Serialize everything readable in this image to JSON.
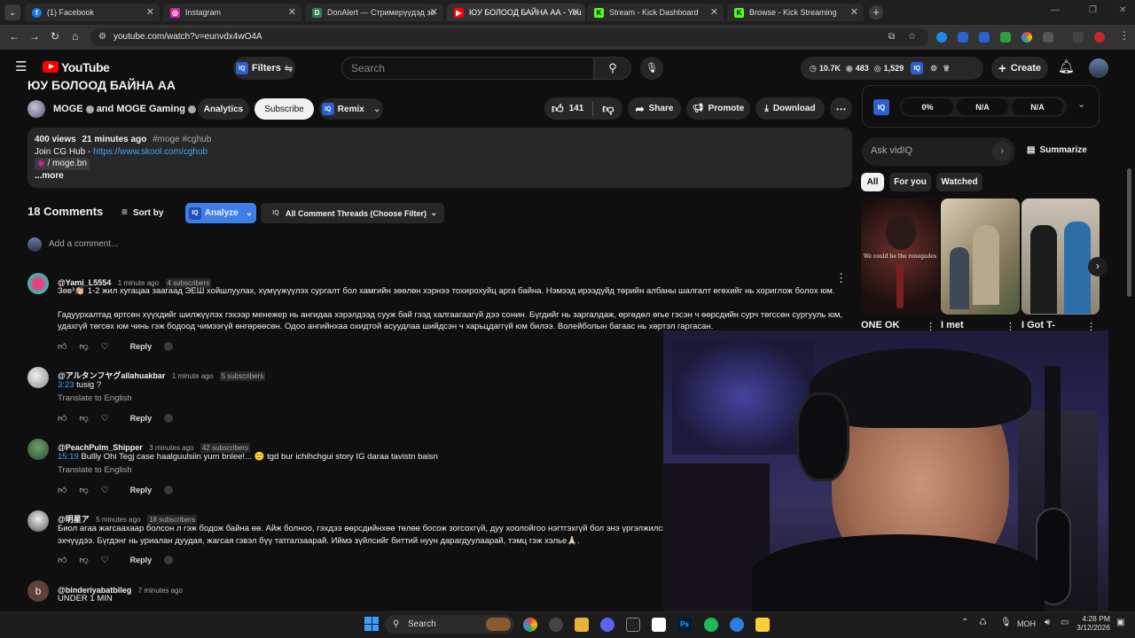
{
  "browser": {
    "tabs": [
      {
        "title": "(1) Facebook",
        "icon": "facebook-icon",
        "color": "#1877f2"
      },
      {
        "title": "Instagram",
        "icon": "instagram-icon",
        "color": "#d6249f"
      },
      {
        "title": "DonAlert — Стримерүүдэд зо",
        "icon": "donalert-icon",
        "color": "#2e7d4f"
      },
      {
        "title": "ЮУ БОЛООД БАЙНА АА - You",
        "icon": "youtube-icon",
        "color": "#ff0000"
      },
      {
        "title": "Stream - Kick Dashboard",
        "icon": "kick-icon",
        "color": "#53fc18"
      },
      {
        "title": "Browse - Kick Streaming",
        "icon": "kick-icon",
        "color": "#53fc18"
      }
    ],
    "url": "youtube.com/watch?v=eunvdx4wO4A"
  },
  "header": {
    "logo": "YouTube",
    "filters_label": "Filters",
    "search_placeholder": "Search",
    "stats": [
      "10.7K",
      "483",
      "1,529"
    ],
    "create_label": "Create"
  },
  "video": {
    "title": "ЮУ БОЛООД БАЙНА АА",
    "channel": "MOGE",
    "and_text": "and",
    "channel2": "MOGE Gaming",
    "analytics_label": "Analytics",
    "subscribe_label": "Subscribe",
    "remix_label": "Remix",
    "likes": "141",
    "share_label": "Share",
    "promote_label": "Promote",
    "download_label": "Download"
  },
  "description": {
    "views": "400 views",
    "time": "21 minutes ago",
    "tags": "#moge #cghub",
    "join_text": "Join CG Hub -",
    "join_link": "https://www.skool.com/cghub",
    "insta": "/ moge.bn",
    "more": "...more"
  },
  "comments_header": {
    "count": "18 Comments",
    "sort_label": "Sort by",
    "analyze_label": "Analyze",
    "filter_label": "All Comment Threads (Choose Filter)",
    "add_placeholder": "Add a comment..."
  },
  "comments": [
    {
      "author": "@Yami_L5554",
      "time": "1 minute ago",
      "subs": "4 subscribers",
      "line1": "Зөв³👏🏼 1-2 жил хугацаа заагаад ЭЕШ хойшлуулах, хүмүүжүүлэх сургалт бол хамгийн зөөлөн хэрнээ тохирохуйц арга байна. Нэмээд ирээдүйд төрийн албаны шалгалт өгөхийг нь хориглож болох юм.",
      "line2": "Гадуурхалтад өртсөн хүүхдийг шилжүүлэх гэхээр менежер нь ангидаа хэрэлдээд сууж бай гээд халгаагаагүй дээ сонин. Бүгдийг нь заргалдаж, өргөдөл өгье гэсэн ч өөрсдийн сурч төгссөн сургууль юм,",
      "line3": "удахгүй төгсөх юм чинь гэж бодоод чимээгүй өнгөрөөсөн. Одоо   ангийнхаа охидтой асуудлаа шийдсэн ч харьцдаггүй юм билээ. Волейболын багаас нь хөртэл гаргасан.",
      "reply": "Reply"
    },
    {
      "author": "@アルタンフヤグallahuakbar",
      "time": "1 minute ago",
      "subs": "5 subscribers",
      "timestamp": "3:23",
      "text": "tusig ?",
      "translate": "Translate to English",
      "reply": "Reply"
    },
    {
      "author": "@PeachPulm_Shipper",
      "time": "3 minutes ago",
      "subs": "42 subscribers",
      "timestamp": "15:19",
      "text": "Bullly Ohi Tegj case haalguulsiin yum bnlee!...  🙁  tgd  bur ichihchgui story IG daraa tavistn baisn",
      "translate": "Translate to English",
      "reply": "Reply"
    },
    {
      "author": "@明星ア",
      "time": "5 minutes ago",
      "subs": "18 subscribers",
      "line1": "Биол агаа жагсаахаар болсон л гэж бодож байна өө. Айж болноо, гэхдээ өөрсдийнхөө төлөө босож зогсохгүй, дуу хоолойгоо нэгтгэхгүй бол энэ үргэлжилсэ",
      "line2": "эхчүүдээ. Бүгдэнг нь уриалан дуудая, жагсая гэвэл бүү татгалзаарай. Иймэ зүйлсийг биттий нуун дарагдуулаарай, тэмц гэж хэлье🙏🏻.",
      "reply": "Reply"
    },
    {
      "author": "@binderiyabatbileg",
      "time": "7 minutes ago",
      "text": "UNDER 1 MIN",
      "avatar_letter": "b"
    }
  ],
  "sidebar": {
    "vidiq_stats": [
      "0%",
      "N/A",
      "N/A"
    ],
    "ask_placeholder": "Ask vidIQ",
    "summarize_label": "Summarize",
    "chips": [
      "All",
      "For you",
      "Watched"
    ],
    "thumb_overlay_text": "We could be the renegades",
    "videos": [
      "ONE OK",
      "I met",
      "I Got T-"
    ]
  },
  "taskbar": {
    "search_label": "Search",
    "lang": "МОН",
    "time": "4:28 PM",
    "date": "3/12/2026"
  }
}
